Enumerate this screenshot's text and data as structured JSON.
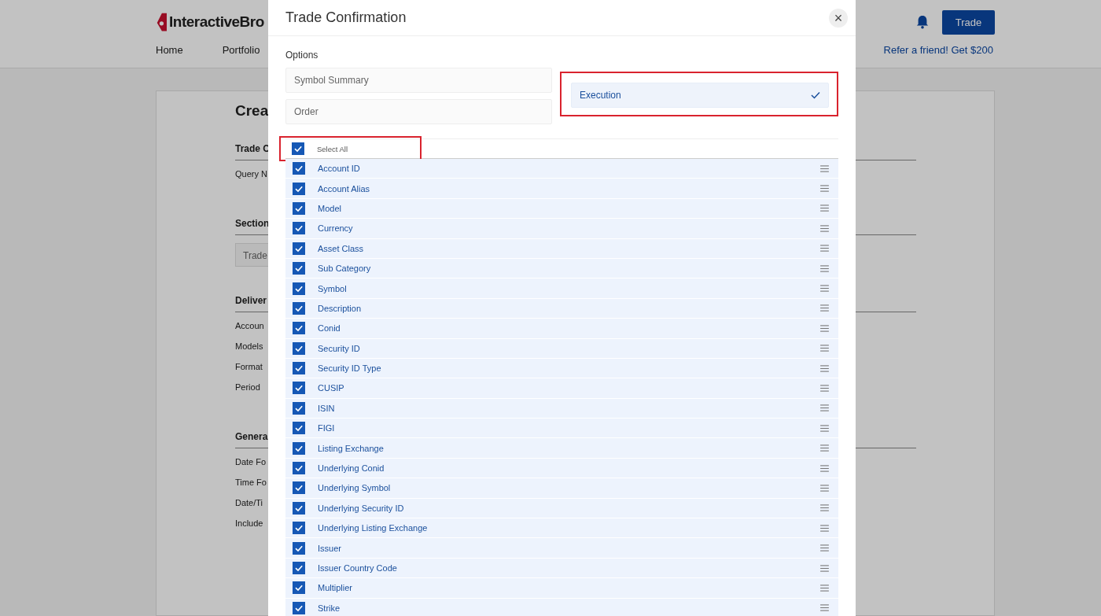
{
  "header": {
    "logo": "InteractiveBro",
    "nav": [
      {
        "label": "Home"
      },
      {
        "label": "Portfolio"
      }
    ],
    "trade_button": "Trade",
    "refer_link": "Refer a friend! Get $200"
  },
  "background_form": {
    "title": "Crea",
    "sections": [
      {
        "heading": "Trade C",
        "labels": [
          "Query N"
        ]
      },
      {
        "heading": "Section",
        "field_value": "Trade"
      },
      {
        "heading": "Deliver",
        "labels": [
          "Accoun",
          "Models",
          "Format",
          "Period"
        ]
      },
      {
        "heading": "Genera",
        "labels": [
          "Date Fo",
          "Time Fo",
          "Date/Ti",
          "Include"
        ]
      }
    ]
  },
  "modal": {
    "title": "Trade Confirmation",
    "close": "×",
    "options_label": "Options",
    "option_columns": [
      [
        {
          "label": "Symbol Summary",
          "selected": false,
          "highlighted": false
        },
        {
          "label": "Order",
          "selected": false,
          "highlighted": false
        }
      ],
      [
        {
          "label": "Execution",
          "selected": true,
          "highlighted": true
        }
      ]
    ],
    "select_all": {
      "label": "Select All",
      "checked": true,
      "highlighted": true
    },
    "fields": [
      {
        "label": "Account ID",
        "checked": true
      },
      {
        "label": "Account Alias",
        "checked": true
      },
      {
        "label": "Model",
        "checked": true
      },
      {
        "label": "Currency",
        "checked": true
      },
      {
        "label": "Asset Class",
        "checked": true
      },
      {
        "label": "Sub Category",
        "checked": true
      },
      {
        "label": "Symbol",
        "checked": true
      },
      {
        "label": "Description",
        "checked": true
      },
      {
        "label": "Conid",
        "checked": true
      },
      {
        "label": "Security ID",
        "checked": true
      },
      {
        "label": "Security ID Type",
        "checked": true
      },
      {
        "label": "CUSIP",
        "checked": true
      },
      {
        "label": "ISIN",
        "checked": true
      },
      {
        "label": "FIGI",
        "checked": true
      },
      {
        "label": "Listing Exchange",
        "checked": true
      },
      {
        "label": "Underlying Conid",
        "checked": true
      },
      {
        "label": "Underlying Symbol",
        "checked": true
      },
      {
        "label": "Underlying Security ID",
        "checked": true
      },
      {
        "label": "Underlying Listing Exchange",
        "checked": true
      },
      {
        "label": "Issuer",
        "checked": true
      },
      {
        "label": "Issuer Country Code",
        "checked": true
      },
      {
        "label": "Multiplier",
        "checked": true
      },
      {
        "label": "Strike",
        "checked": true
      }
    ]
  }
}
